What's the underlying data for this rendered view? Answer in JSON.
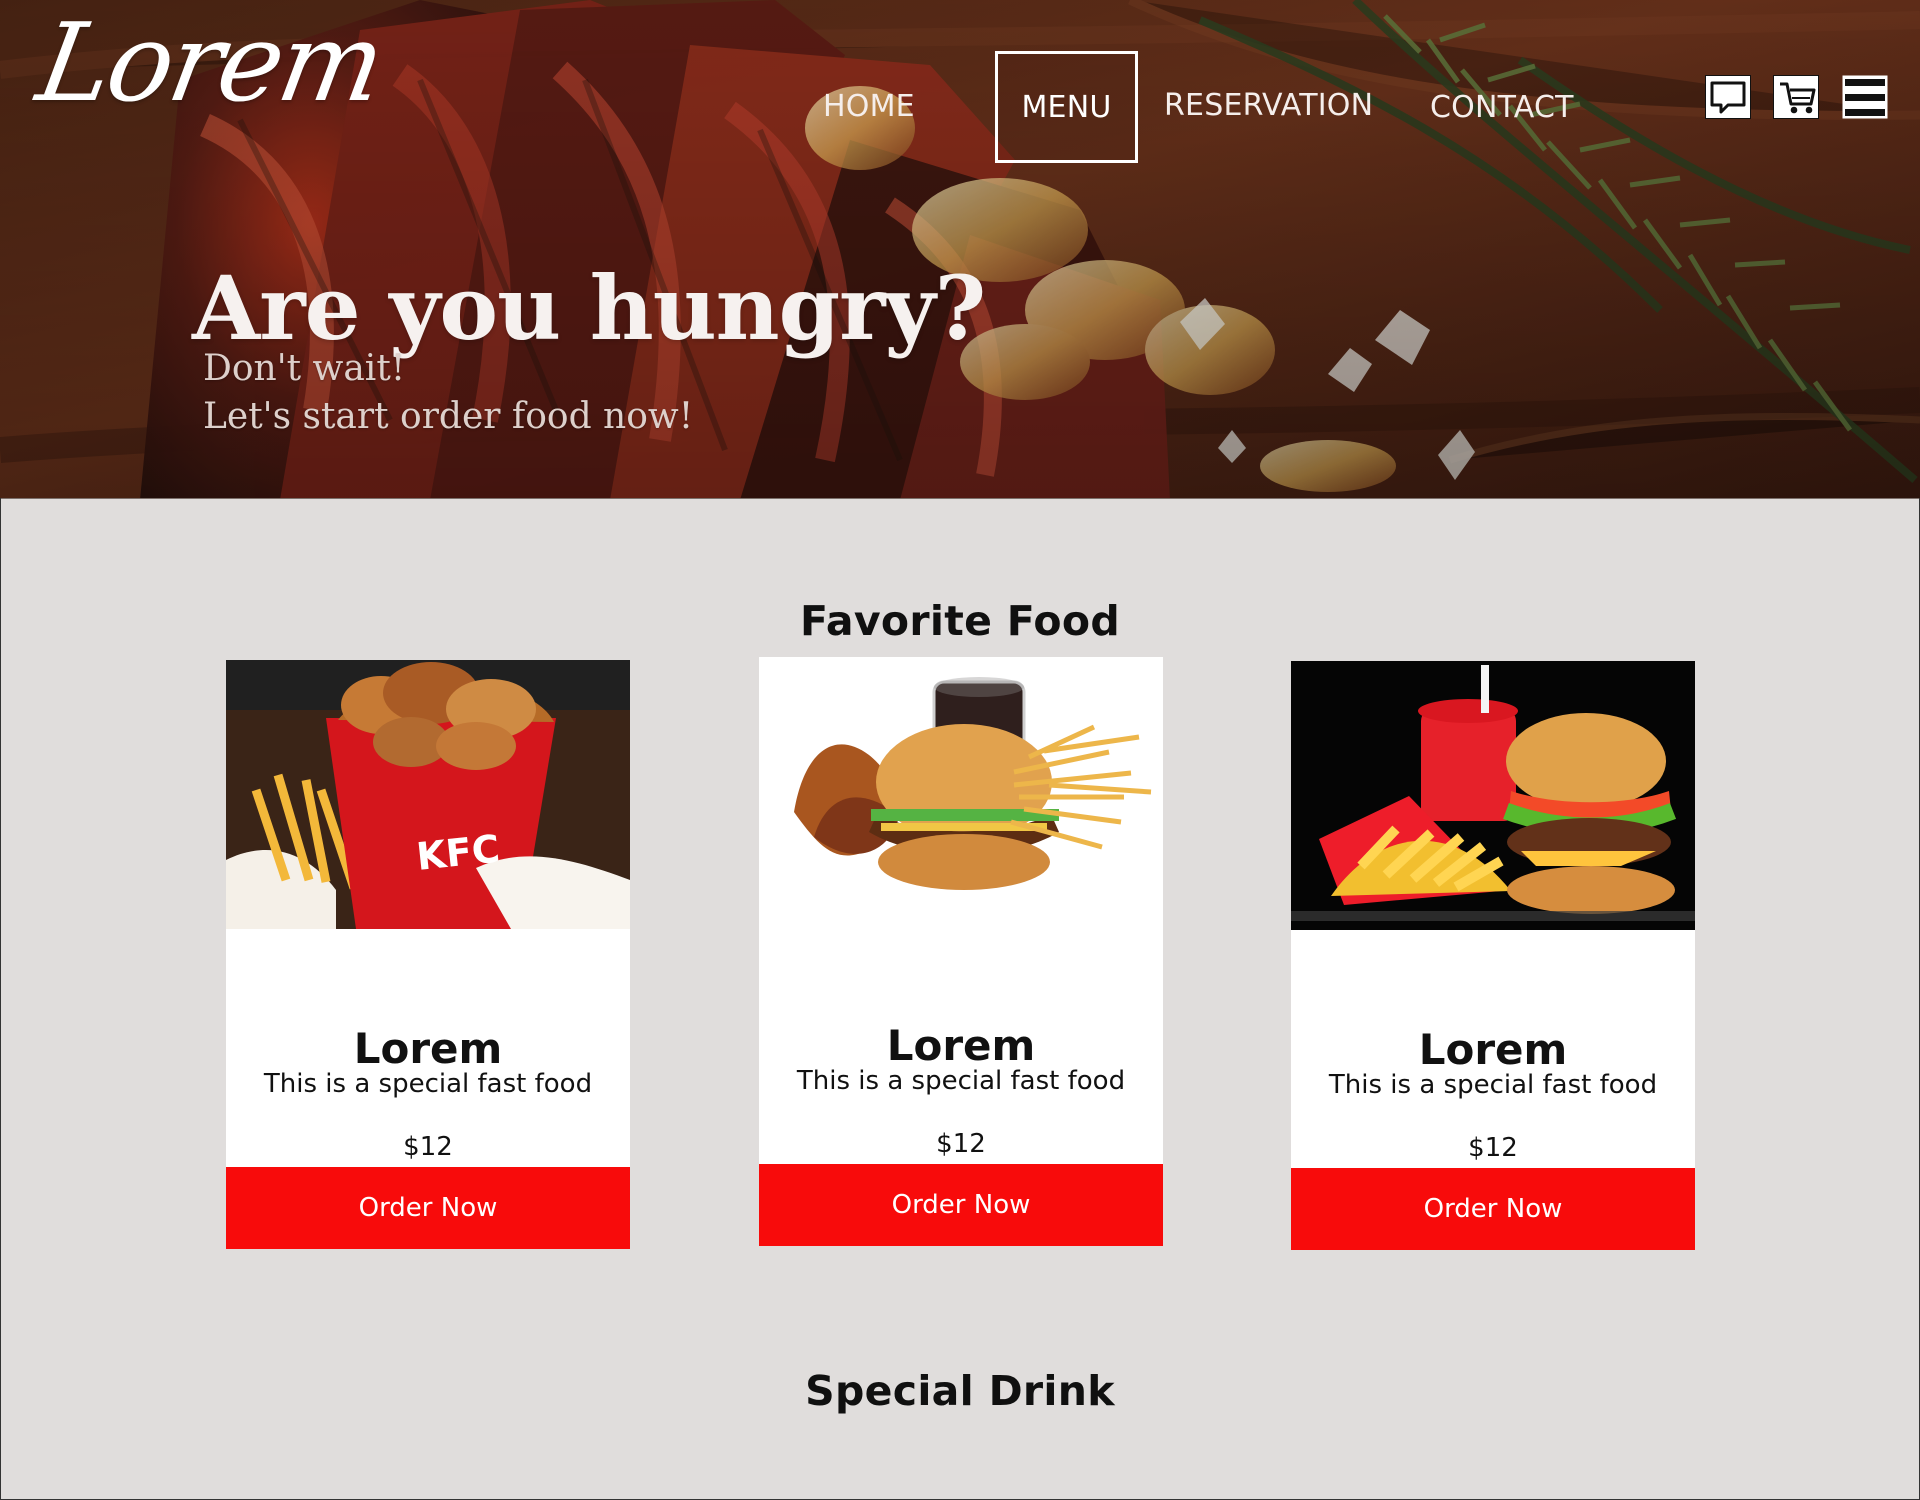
{
  "brand": {
    "logo_text": "Lorem"
  },
  "navigation": {
    "items": [
      {
        "label": "HOME",
        "active": false
      },
      {
        "label": "MENU",
        "active": true
      },
      {
        "label": "RESERVATION",
        "active": false
      },
      {
        "label": "CONTACT",
        "active": false
      }
    ],
    "icons": [
      "chat-bubble-icon",
      "shopping-cart-icon",
      "hamburger-menu-icon"
    ]
  },
  "hero": {
    "title": "Are you hungry?",
    "subtitle_line_1": "Don't wait!",
    "subtitle_line_2": "Let's start order food now!"
  },
  "favorite_food": {
    "title": "Favorite Food",
    "cards": [
      {
        "title": "Lorem",
        "description": "This is a special fast food",
        "price": "$12",
        "button_label": "Order Now",
        "image_text": "KFC"
      },
      {
        "title": "Lorem",
        "description": "This is a special fast food",
        "price": "$12",
        "button_label": "Order Now"
      },
      {
        "title": "Lorem",
        "description": "This is a special fast food",
        "price": "$12",
        "button_label": "Order Now"
      }
    ]
  },
  "special_drink": {
    "title": "Special Drink"
  },
  "colors": {
    "page_background": "#e0dddc",
    "card_background": "#ffffff",
    "order_button": "#f80b0b",
    "hero_text": "#f6f1ef",
    "dark_text": "#111111"
  }
}
